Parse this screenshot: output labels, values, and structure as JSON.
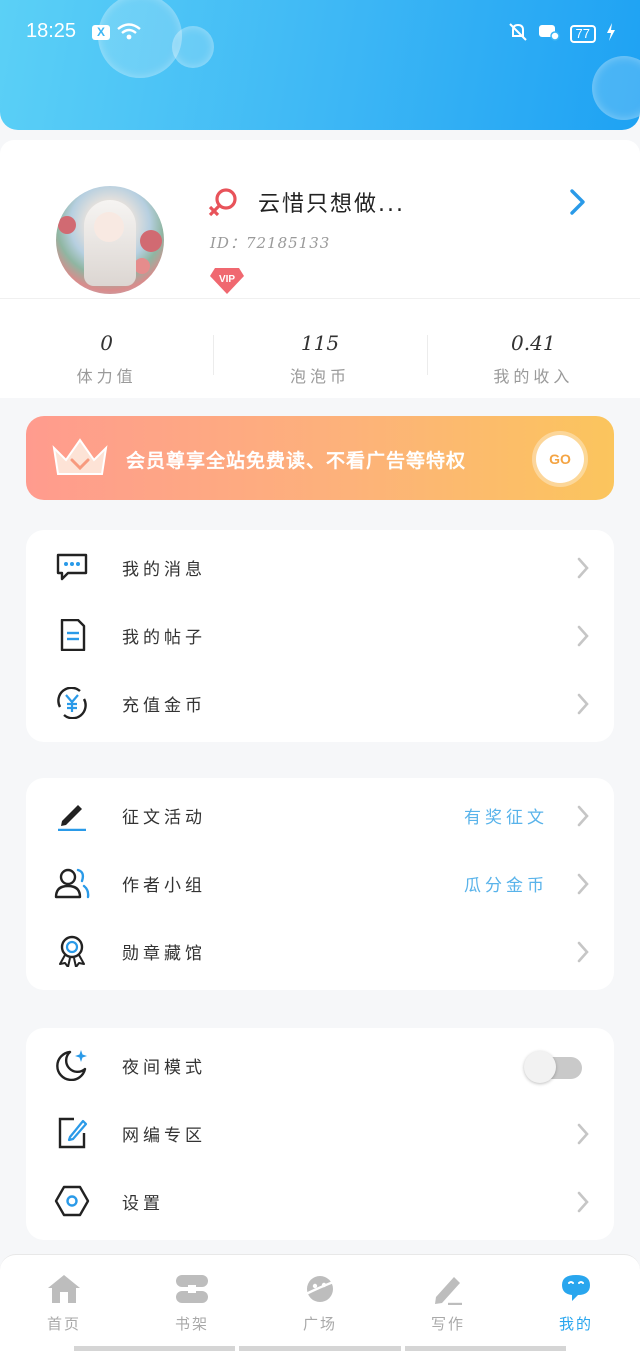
{
  "status_bar": {
    "time": "18:25",
    "notification_badge": "X",
    "battery": "77"
  },
  "profile": {
    "username": "云惜只想做...",
    "user_id": "ID：72185133",
    "vip_badge": "VIP",
    "gender_icon": "female-icon"
  },
  "stats": [
    {
      "value": "0",
      "label": "体力值"
    },
    {
      "value": "115",
      "label": "泡泡币"
    },
    {
      "value": "0.41",
      "label": "我的收入"
    }
  ],
  "vip_banner": {
    "text": "会员尊享全站免费读、不看广告等特权",
    "go_label": "GO"
  },
  "menu_group_1": [
    {
      "label": "我的消息",
      "icon": "message-icon"
    },
    {
      "label": "我的帖子",
      "icon": "document-icon"
    },
    {
      "label": "充值金币",
      "icon": "yuan-coin-icon"
    }
  ],
  "menu_group_2": [
    {
      "label": "征文活动",
      "hint": "有奖征文",
      "icon": "pen-icon"
    },
    {
      "label": "作者小组",
      "hint": "瓜分金币",
      "icon": "group-icon"
    },
    {
      "label": "勋章藏馆",
      "icon": "medal-icon"
    }
  ],
  "menu_group_3": [
    {
      "label": "夜间模式",
      "icon": "moon-icon",
      "toggle_on": false
    },
    {
      "label": "网编专区",
      "icon": "edit-icon"
    },
    {
      "label": "设置",
      "icon": "settings-icon"
    }
  ],
  "bottom_nav": [
    {
      "label": "首页",
      "icon": "home-icon",
      "active": false
    },
    {
      "label": "书架",
      "icon": "bookshelf-icon",
      "active": false
    },
    {
      "label": "广场",
      "icon": "planet-icon",
      "active": false
    },
    {
      "label": "写作",
      "icon": "pencil-icon",
      "active": false
    },
    {
      "label": "我的",
      "icon": "profile-chat-icon",
      "active": true
    }
  ],
  "colors": {
    "header_start": "#5bd0f6",
    "header_end": "#1ea2f3",
    "accent_blue": "#29a6ee",
    "hint_blue": "#59b3ea",
    "banner_start": "#ff9b8e",
    "banner_end": "#fbc55d",
    "gender_red": "#e8535a"
  }
}
